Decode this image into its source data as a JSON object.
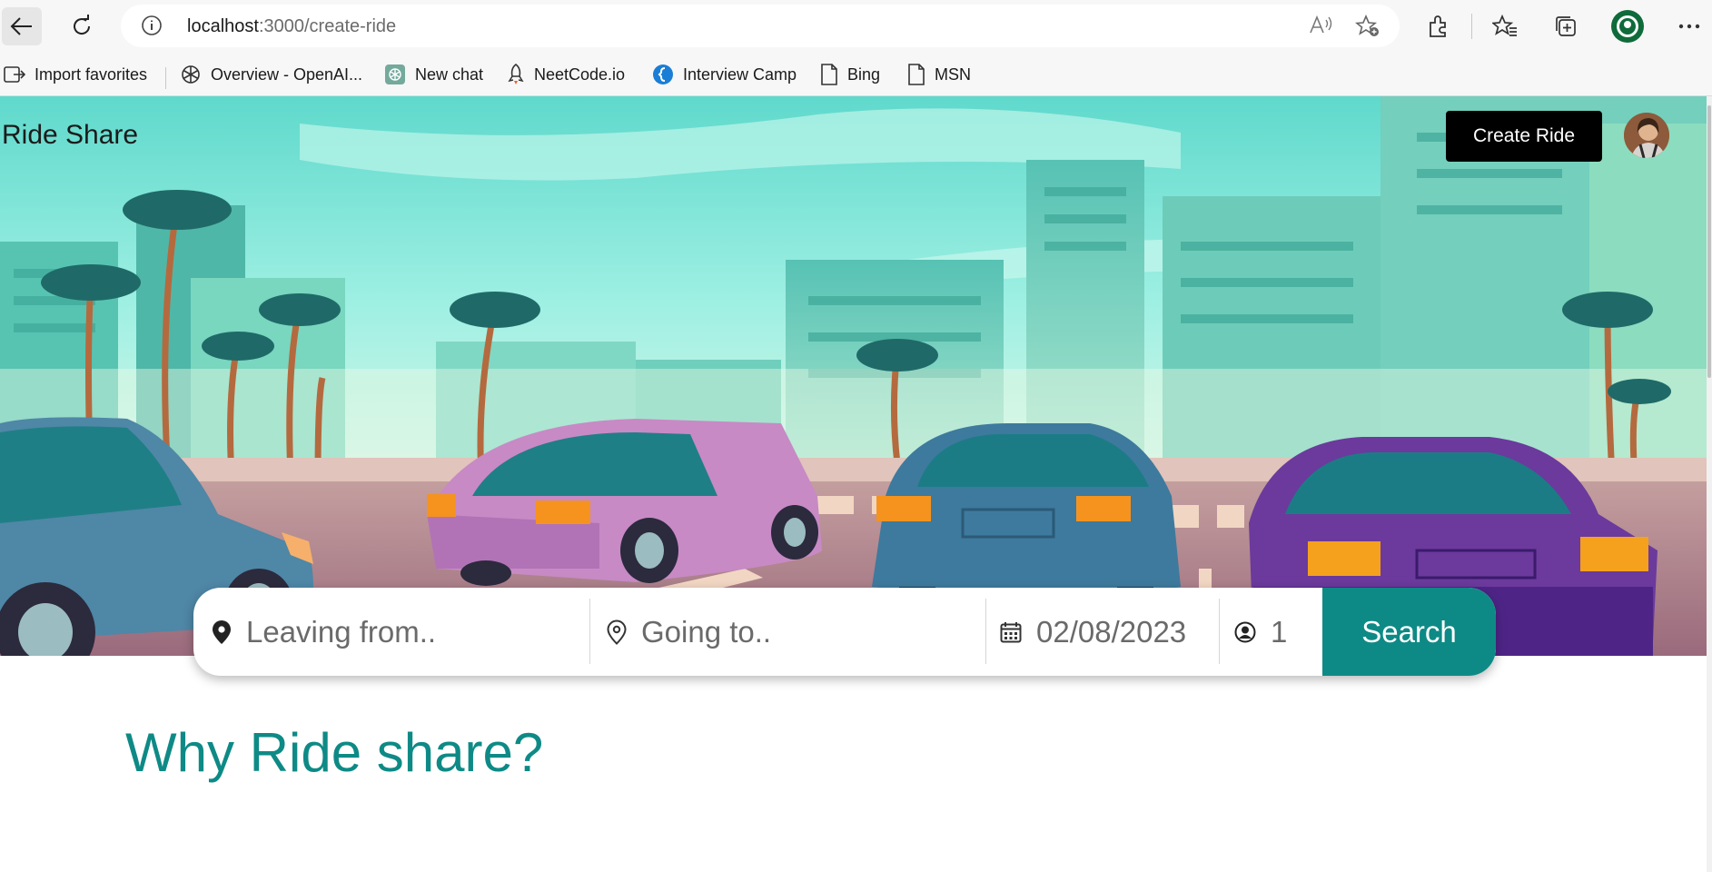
{
  "browser": {
    "url_host": "localhost",
    "url_path": ":3000/create-ride",
    "bookmarks": [
      {
        "label": "Import favorites",
        "icon": "import-icon"
      },
      {
        "label": "Overview - OpenAI...",
        "icon": "openai-icon"
      },
      {
        "label": "New chat",
        "icon": "chatgpt-icon"
      },
      {
        "label": "NeetCode.io",
        "icon": "rocket-icon"
      },
      {
        "label": "Interview Camp",
        "icon": "interview-camp-icon"
      },
      {
        "label": "Bing",
        "icon": "page-icon"
      },
      {
        "label": "MSN",
        "icon": "page-icon"
      }
    ]
  },
  "app": {
    "brand": "Ride Share",
    "create_ride_label": "Create Ride",
    "accent_color": "#0e8a86"
  },
  "search": {
    "leaving_placeholder": "Leaving from..",
    "going_placeholder": "Going to..",
    "date_value": "02/08/2023",
    "passengers_value": "1",
    "search_label": "Search"
  },
  "section": {
    "heading": "Why Ride share?"
  }
}
